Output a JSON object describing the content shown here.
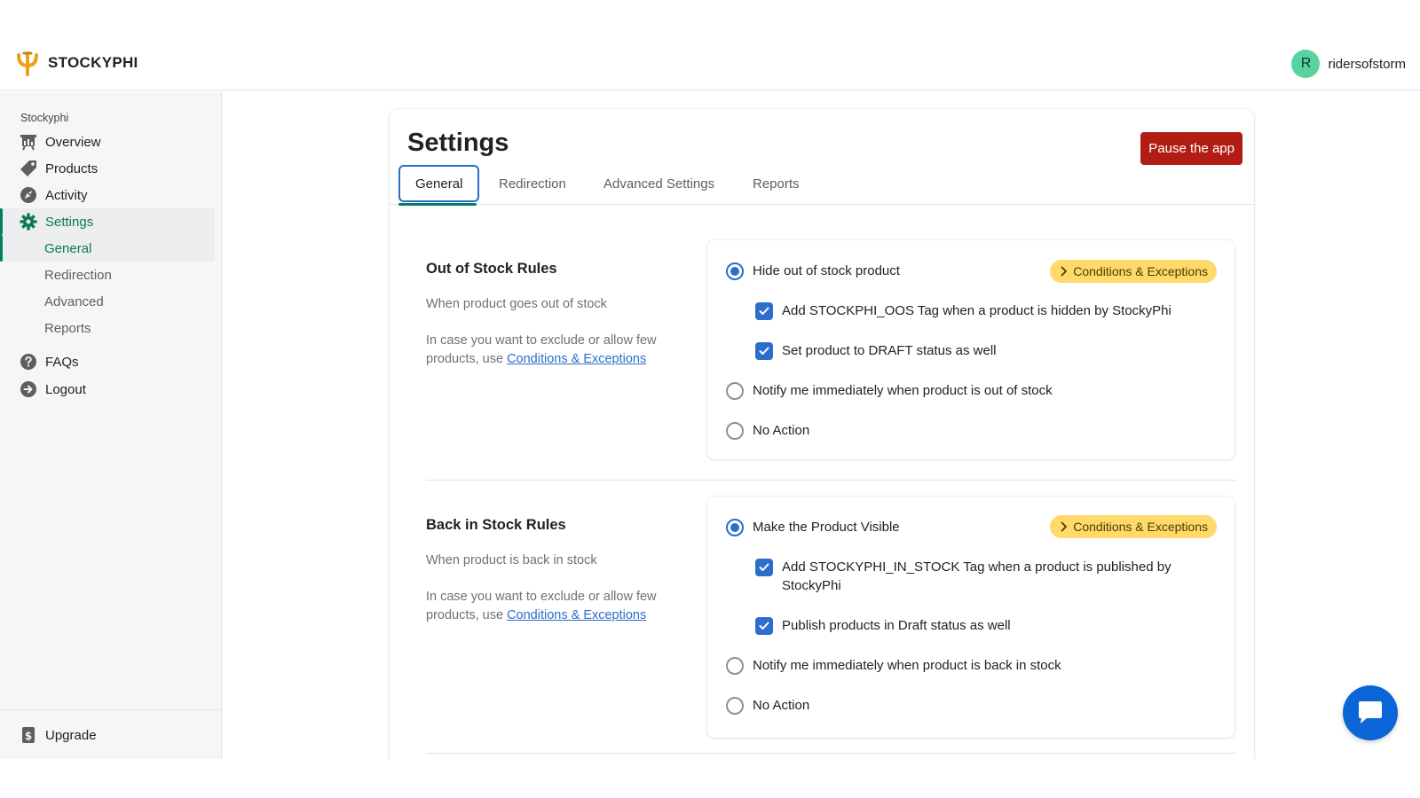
{
  "brand": {
    "name": "STOCKYPHI"
  },
  "user": {
    "initial": "R",
    "name": "ridersofstorm"
  },
  "sidebar": {
    "section": "Stockyphi",
    "items": [
      {
        "label": "Overview",
        "icon": "chart-board-icon"
      },
      {
        "label": "Products",
        "icon": "tag-icon"
      },
      {
        "label": "Activity",
        "icon": "rocket-icon"
      },
      {
        "label": "Settings",
        "icon": "gear-icon"
      }
    ],
    "settings_sub": [
      "General",
      "Redirection",
      "Advanced",
      "Reports"
    ],
    "faqs": "FAQs",
    "logout": "Logout",
    "upgrade": "Upgrade"
  },
  "page": {
    "title": "Settings",
    "pause_label": "Pause the app",
    "tabs": [
      "General",
      "Redirection",
      "Advanced Settings",
      "Reports"
    ]
  },
  "rules": {
    "out_of_stock": {
      "title": "Out of Stock Rules",
      "desc": "When product goes out of stock",
      "help_prefix": "In case you want to exclude or allow few products, use ",
      "help_link": "Conditions & Exceptions",
      "badge": "Conditions & Exceptions",
      "options": {
        "hide": "Hide out of stock product",
        "tag": "Add STOCKPHI_OOS Tag when a product is hidden by StockyPhi",
        "draft": "Set product to DRAFT status as well",
        "notify": "Notify me immediately when product is out of stock",
        "none": "No Action"
      }
    },
    "back_in_stock": {
      "title": "Back in Stock Rules",
      "desc": "When product is back in stock",
      "help_prefix": "In case you want to exclude or allow few products, use ",
      "help_link": "Conditions & Exceptions",
      "badge": "Conditions & Exceptions",
      "options": {
        "visible": "Make the Product Visible",
        "tag": "Add STOCKYPHI_IN_STOCK Tag when a product is published by StockyPhi",
        "publish": "Publish products in Draft status as well",
        "notify": "Notify me immediately when product is back in stock",
        "none": "No Action"
      }
    }
  },
  "colors": {
    "accent": "#2c6ecb",
    "active_nav": "#008060",
    "danger": "#b11d14",
    "badge": "#ffd96a",
    "chat": "#0a66d6"
  }
}
